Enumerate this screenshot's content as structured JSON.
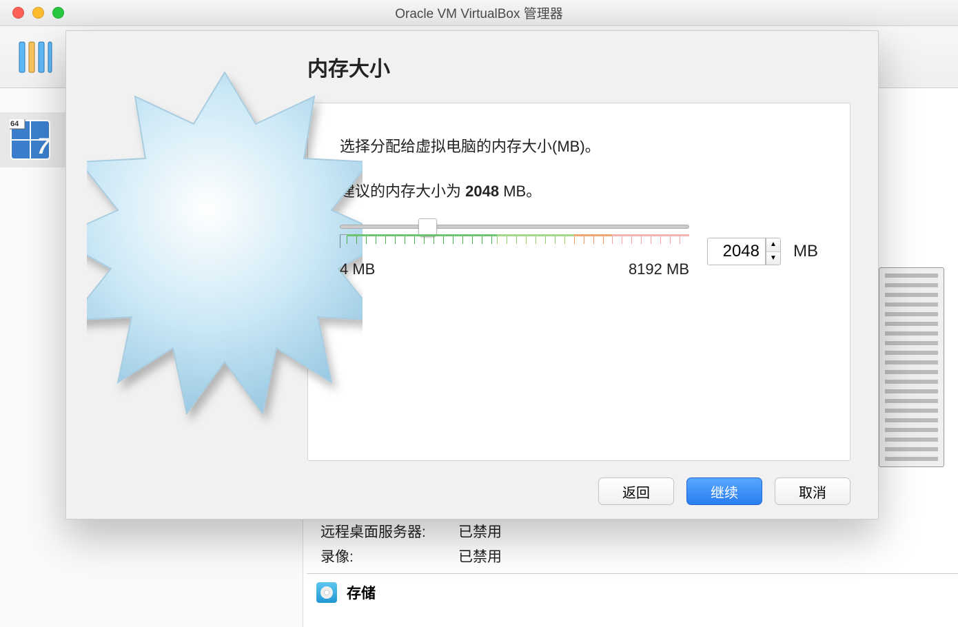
{
  "window": {
    "title": "Oracle VM VirtualBox 管理器"
  },
  "sidebar": {
    "vm_badge": "64",
    "vm_icon_text": "7"
  },
  "dialog": {
    "title": "内存大小",
    "desc1": "选择分配给虚拟电脑的内存大小(MB)。",
    "recommend_prefix": "建议的内存大小为 ",
    "recommend_value": "2048",
    "recommend_suffix": " MB。",
    "slider": {
      "min_label": "4 MB",
      "max_label": "8192 MB",
      "min": 4,
      "max": 8192,
      "value": 2048,
      "knob_percent": 25
    },
    "input_value": "2048",
    "unit": "MB",
    "buttons": {
      "back": "返回",
      "continue": "继续",
      "cancel": "取消"
    }
  },
  "background_info": {
    "remote_desktop_label": "远程桌面服务器:",
    "remote_desktop_value": "已禁用",
    "video_label": "录像:",
    "video_value": "已禁用",
    "storage_header": "存储"
  },
  "colors": {
    "primary_blue": "#2a7def",
    "slider_green": "#6ec46e",
    "slider_orange": "#f0a774",
    "slider_pink": "#f5b3b3"
  }
}
